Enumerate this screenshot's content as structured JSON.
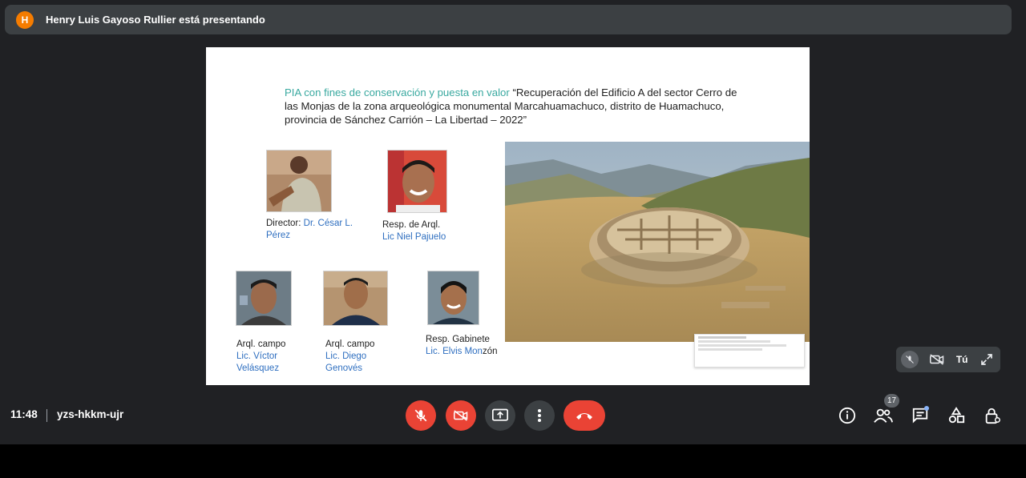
{
  "banner": {
    "avatar_letter": "H",
    "text": "Henry Luis Gayoso Rullier está presentando"
  },
  "slide": {
    "title_lead": "PIA con fines de conservación y puesta en valor",
    "title_rest": " “Recuperación del Edificio A del sector Cerro de las Monjas de la zona arqueológica monumental Marcahuamachuco, distrito de Huamachuco, provincia de Sánchez Carrión – La Libertad – 2022”",
    "people": [
      {
        "role": "Director: ",
        "name": "Dr. César L. Pérez"
      },
      {
        "role": "Resp. de Arql.",
        "name": "Lic Niel Pajuelo"
      },
      {
        "role": "Arql. campo",
        "name": "Lic. Víctor Velásquez"
      },
      {
        "role": "Arql. campo",
        "name": "Lic. Diego Genovés"
      },
      {
        "role": "Resp. Gabinete",
        "name": "Lic. Elvis Mon",
        "name_tail": "zón"
      }
    ]
  },
  "self_tile": {
    "label": "Tú"
  },
  "bottom": {
    "time": "11:48",
    "meeting_code": "yzs-hkkm-ujr",
    "participants_count": "17"
  },
  "colors": {
    "end_call": "#ea4335",
    "bar": "#202124",
    "teal": "#3aa9a0",
    "blue": "#2f6fc0"
  }
}
